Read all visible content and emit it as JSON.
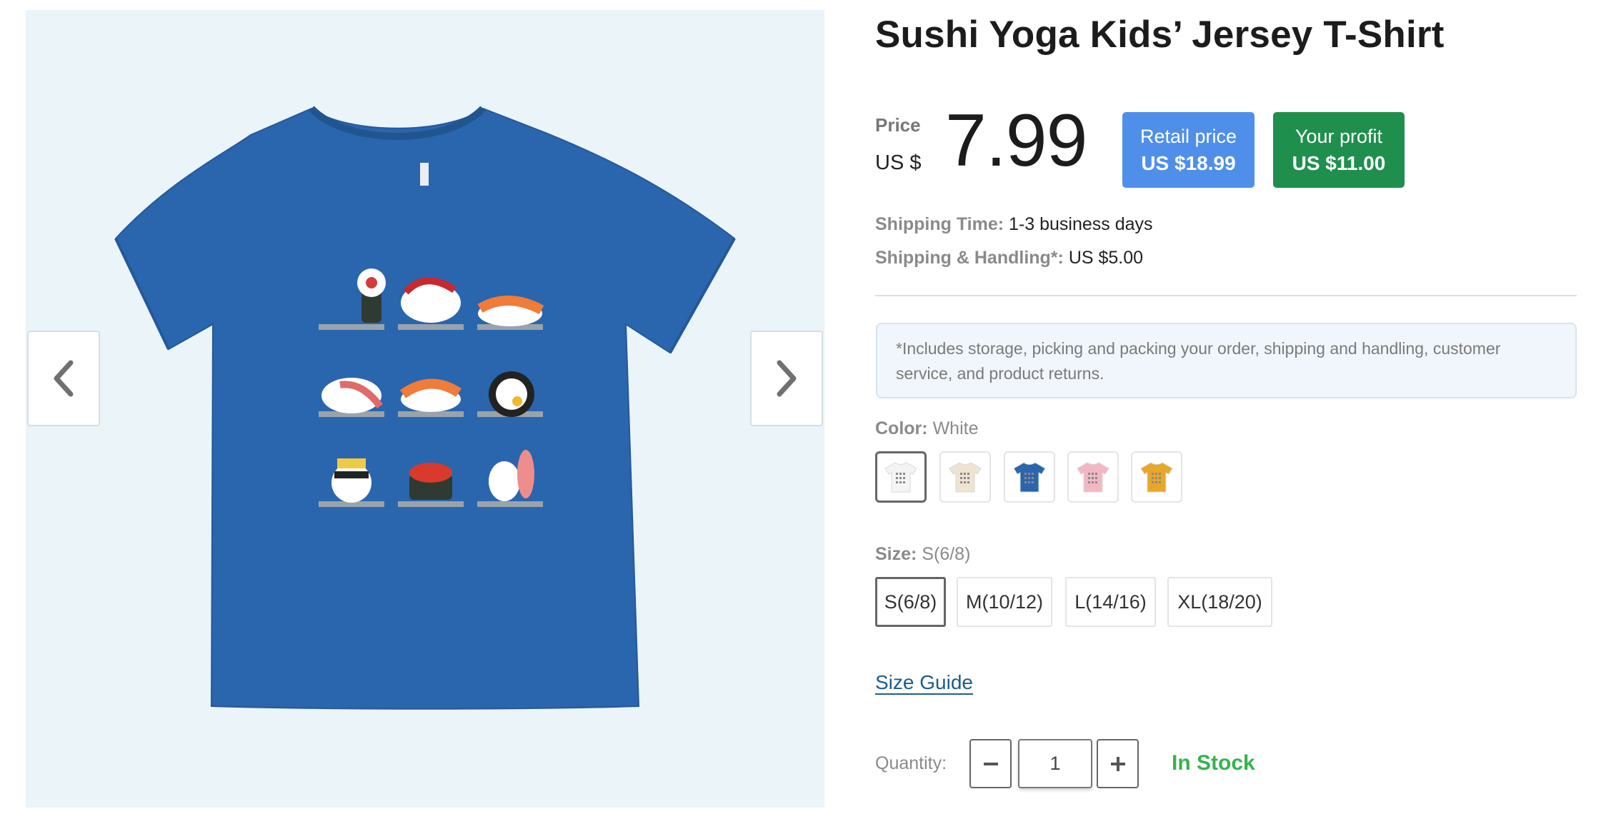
{
  "product": {
    "title": "Sushi Yoga Kids’ Jersey T-Shirt",
    "image_icon": "blue-tshirt-sushi-yoga-print"
  },
  "gallery": {
    "prev_icon": "chevron-left-icon",
    "next_icon": "chevron-right-icon"
  },
  "price": {
    "label": "Price",
    "currency": "US $",
    "value": "7.99",
    "retail_label": "Retail price",
    "retail_value": "US $18.99",
    "profit_label": "Your profit",
    "profit_value": "US $11.00",
    "retail_color": "#4f8fea",
    "profit_color": "#1f8f4e"
  },
  "shipping": {
    "time_label": "Shipping Time:",
    "time_value": "1-3 business days",
    "handling_label": "Shipping & Handling*:",
    "handling_value": "US $5.00"
  },
  "notice": "*Includes storage, picking and packing your order, shipping and handling, customer service, and product returns.",
  "color": {
    "label": "Color:",
    "selected": "White",
    "swatches": [
      {
        "name": "White",
        "hex": "#f4f4f4"
      },
      {
        "name": "Natural",
        "hex": "#efe3d2"
      },
      {
        "name": "Blue",
        "hex": "#2a66ad"
      },
      {
        "name": "Pink",
        "hex": "#f3b7c3"
      },
      {
        "name": "Gold",
        "hex": "#e7a72a"
      }
    ]
  },
  "size": {
    "label": "Size:",
    "selected": "S(6/8)",
    "options": [
      "S(6/8)",
      "M(10/12)",
      "L(14/16)",
      "XL(18/20)"
    ]
  },
  "size_guide": "Size Guide",
  "quantity": {
    "label": "Quantity:",
    "value": "1",
    "decrement_icon": "minus-icon",
    "increment_icon": "plus-icon"
  },
  "stock_status": "In Stock",
  "colors": {
    "stock": "#37b24d",
    "link": "#1d5d8a",
    "shirt": "#2a66ad"
  }
}
